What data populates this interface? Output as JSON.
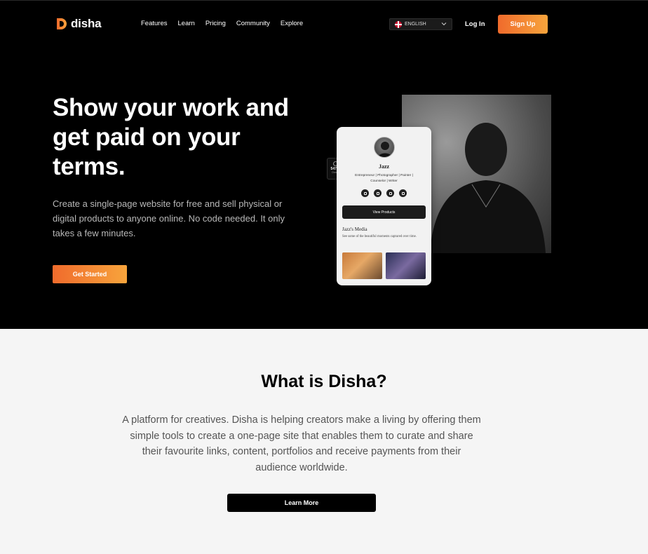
{
  "brand": {
    "name": "disha",
    "accent_start": "#f06b2c",
    "accent_end": "#f7a43c"
  },
  "nav": {
    "links": [
      "Features",
      "Learn",
      "Pricing",
      "Community",
      "Explore"
    ],
    "language": {
      "selected": "ENGLISH",
      "flag_icon": "uk-flag-icon"
    },
    "login_label": "Log In",
    "signup_label": "Sign Up"
  },
  "hero": {
    "title": "Show your work and get paid on your terms.",
    "subtitle": "Create a single-page website for free and sell physical or digital products to anyone online. No code needed. It only takes a few minutes.",
    "cta_label": "Get Started"
  },
  "profile_card": {
    "name": "Jazz",
    "roles": "Entrepreneur | Photographer | Painter | Counselor | Writer",
    "social_icons": [
      "youtube-icon",
      "instagram-icon",
      "globe-icon",
      "linkedin-icon"
    ],
    "view_products_label": "View Products",
    "media_title": "Jazz's Media",
    "media_desc": "See some of the beautiful moments captured over time.",
    "stat": {
      "value": "54768",
      "label": "Orders"
    }
  },
  "about": {
    "title": "What is Disha?",
    "text": "A platform for creatives. Disha is helping creators make a living by offering them simple tools to create a one-page site that enables them to curate and share their favourite links, content, portfolios and receive payments from their audience worldwide.",
    "cta_label": "Learn More"
  }
}
